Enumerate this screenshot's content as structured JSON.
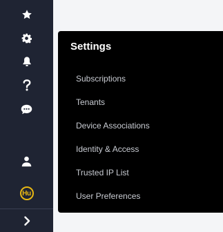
{
  "sidebar": {
    "background": "#1f2433",
    "icon_color": "#ffffff",
    "items": [
      {
        "icon": "star-icon",
        "label": "Favorites"
      },
      {
        "icon": "gear-icon",
        "label": "Settings"
      },
      {
        "icon": "bell-icon",
        "label": "Notifications"
      },
      {
        "icon": "help-icon",
        "label": "Help"
      },
      {
        "icon": "chat-icon",
        "label": "Chat"
      },
      {
        "icon": "user-icon",
        "label": "Account"
      }
    ],
    "avatar": {
      "initials": "Hu",
      "color": "#e8b713"
    },
    "expand_icon": "chevron-right-icon"
  },
  "settings_panel": {
    "title": "Settings",
    "items": [
      "Subscriptions",
      "Tenants",
      "Device Associations",
      "Identity & Access",
      "Trusted IP List",
      "User Preferences"
    ]
  }
}
